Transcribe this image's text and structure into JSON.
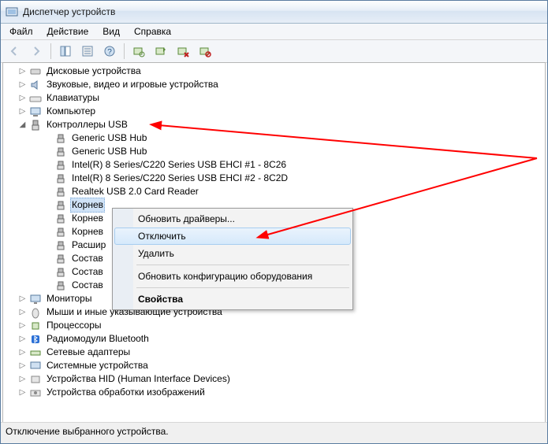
{
  "window": {
    "title": "Диспетчер устройств"
  },
  "menu": {
    "file": "Файл",
    "action": "Действие",
    "view": "Вид",
    "help": "Справка"
  },
  "status": {
    "text": "Отключение выбранного устройства."
  },
  "context": {
    "update": "Обновить драйверы...",
    "disable": "Отключить",
    "delete": "Удалить",
    "scan": "Обновить конфигурацию оборудования",
    "props": "Свойства"
  },
  "tree": {
    "disks": "Дисковые устройства",
    "audio": "Звуковые, видео и игровые устройства",
    "keyboards": "Клавиатуры",
    "computer": "Компьютер",
    "usb_ctrl": "Контроллеры USB",
    "usb_children": {
      "hub1": "Generic USB Hub",
      "hub2": "Generic USB Hub",
      "intel1": "Intel(R) 8 Series/C220 Series USB EHCI #1 - 8C26",
      "intel2": "Intel(R) 8 Series/C220 Series USB EHCI #2 - 8C2D",
      "realtek": "Realtek USB 2.0 Card Reader",
      "root1": "Корнев",
      "root2": "Корнев",
      "root3": "Корнев",
      "ext": "Расшир",
      "comp1": "Состав",
      "comp2": "Состав",
      "comp3": "Состав"
    },
    "monitors": "Мониторы",
    "mice": "Мыши и иные указывающие устройства",
    "cpus": "Процессоры",
    "bt": "Радиомодули Bluetooth",
    "net": "Сетевые адаптеры",
    "sysdev": "Системные устройства",
    "hid": "Устройства HID (Human Interface Devices)",
    "imaging": "Устройства обработки изображений"
  }
}
